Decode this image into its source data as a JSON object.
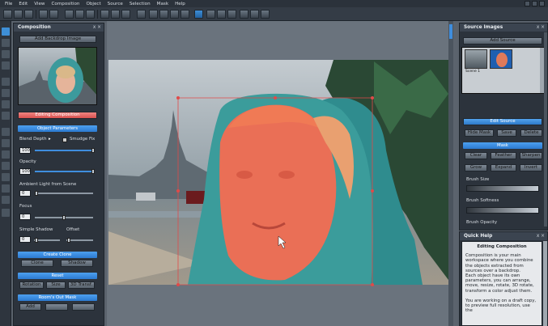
{
  "menu": [
    "File",
    "Edit",
    "View",
    "Composition",
    "Object",
    "Source",
    "Selection",
    "Mask",
    "Help"
  ],
  "composition_panel": {
    "title": "Composition",
    "add_backdrop": "Add Backdrop Image",
    "editing_composition": "Editing Composition",
    "object_parameters": "Object Parameters",
    "blend_depth_label": "Blend Depth",
    "smudge_fix_label": "Smudge Fix",
    "blend_depth_value": "100",
    "opacity_label": "Opacity",
    "opacity_value": "100",
    "ambient_label": "Ambient Light from Scene",
    "ambient_value": "0",
    "focus_label": "Focus",
    "focus_value": "0",
    "simple_shadow_label": "Simple Shadow",
    "offset_label": "Offset",
    "shadow_value": "0",
    "create_clone": "Create Clone",
    "clone_btn": "Clone",
    "shadow_btn": "Shadow",
    "reset": "Reset",
    "rotation_btn": "Rotation",
    "size_btn": "Size",
    "trans3d_btn": "3D Transf.",
    "rooms_section": "Room's Out Mask",
    "add_btn": "Add"
  },
  "source_panel": {
    "title": "Source Images",
    "add_source": "Add Source",
    "thumb1_label": "Scene 1",
    "edit_source": "Edit Source",
    "hide_mask": "Hide Mask",
    "save": "Save",
    "delete": "Delete",
    "mask_section": "Mask",
    "clear": "Clear",
    "feather": "Feather",
    "sharpen": "Sharpen",
    "grow": "Grow",
    "expand": "Expand",
    "invert": "Invert",
    "brush_size": "Brush Size",
    "brush_softness": "Brush Softness",
    "brush_opacity": "Brush Opacity"
  },
  "quick_help": {
    "title": "Quick Help",
    "heading": "Editing Composition",
    "para1": "Composition is your main workspace where you combine the objects extracted from sources over a backdrop.",
    "para2": "Each object have its own parameters, you can arrange, move, resize, rotate, 3D rotate, transform a color adjust them.",
    "para3": "You are working on a draft copy, to preview full resolution, use the"
  },
  "colors": {
    "accent_blue": "#2f7fd1",
    "accent_red": "#e06562",
    "panel_bg": "#2c333c",
    "mask_overlay": "#f06a4e"
  }
}
